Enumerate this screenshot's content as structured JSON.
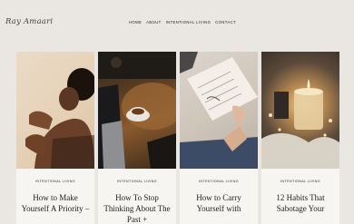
{
  "brand": "Ray Amaari",
  "nav": [
    "HOME",
    "ABOUT",
    "INTENTIONAL LIVING",
    "CONTACT"
  ],
  "posts": [
    {
      "category": "INTENTIONAL LIVING",
      "title": "How to Make Yourself A Priority –"
    },
    {
      "category": "INTENTIONAL LIVING",
      "title": "How To Stop Thinking About The Past +"
    },
    {
      "category": "INTENTIONAL LIVING",
      "title": "How to Carry Yourself with"
    },
    {
      "category": "INTENTIONAL LIVING",
      "title": "12 Habits That Sabotage Your"
    }
  ]
}
